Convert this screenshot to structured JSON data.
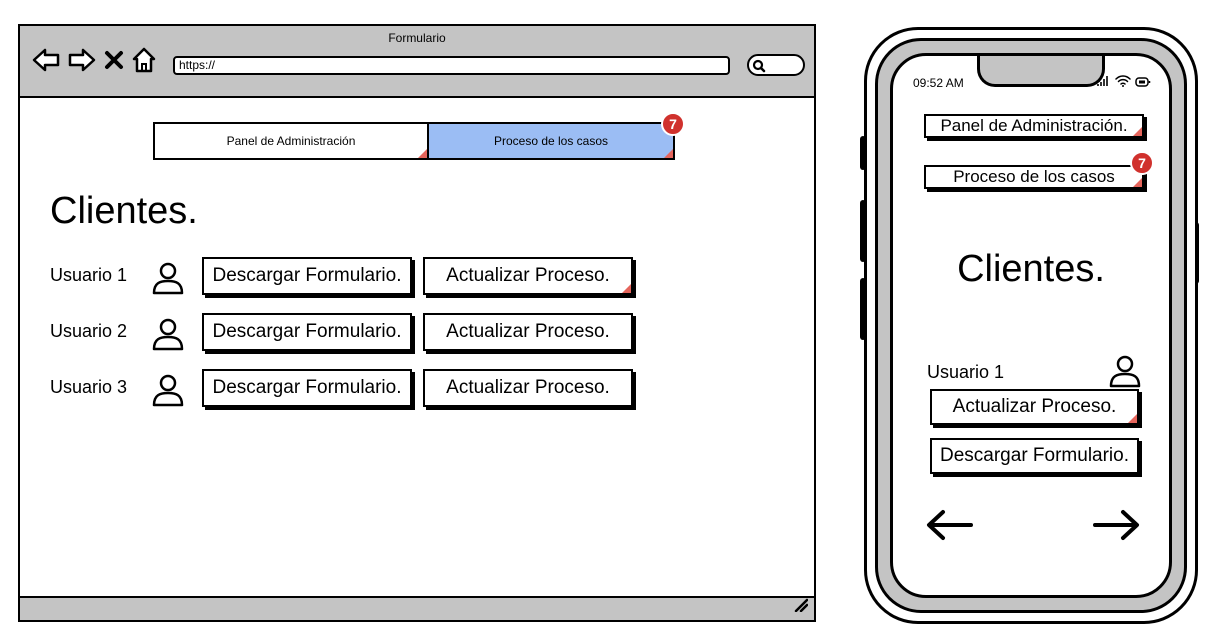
{
  "browser": {
    "window_title": "Formulario",
    "url": "https://",
    "nav_icons": [
      "back-arrow-icon",
      "forward-arrow-icon",
      "close-icon",
      "home-icon"
    ],
    "search_icon": "search-icon",
    "resize_icon": "resize-handle-icon"
  },
  "tabs": [
    {
      "label": "Panel de Administración",
      "active": false
    },
    {
      "label": "Proceso de los casos",
      "active": true,
      "badge": "7",
      "active_color": "#9bbdf4"
    }
  ],
  "main": {
    "heading": "Clientes.",
    "rows": [
      {
        "user": "Usuario 1",
        "download_label": "Descargar Formulario.",
        "update_label": "Actualizar Proceso."
      },
      {
        "user": "Usuario 2",
        "download_label": "Descargar Formulario.",
        "update_label": "Actualizar Proceso."
      },
      {
        "user": "Usuario 3",
        "download_label": "Descargar Formulario.",
        "update_label": "Actualizar Proceso."
      }
    ]
  },
  "mobile": {
    "time": "09:52 AM",
    "admin_label": "Panel de Administración.",
    "process_label": "Proceso de los casos",
    "process_badge": "7",
    "heading": "Clientes.",
    "user": "Usuario 1",
    "update_label": "Actualizar Proceso.",
    "download_label": "Descargar Formulario.",
    "prev_icon": "arrow-left-icon",
    "next_icon": "arrow-right-icon"
  },
  "colors": {
    "badge": "#d0312d",
    "active_tab": "#9bbdf4",
    "chrome": "#c4c4c4",
    "link_mark": "#e5655c"
  }
}
